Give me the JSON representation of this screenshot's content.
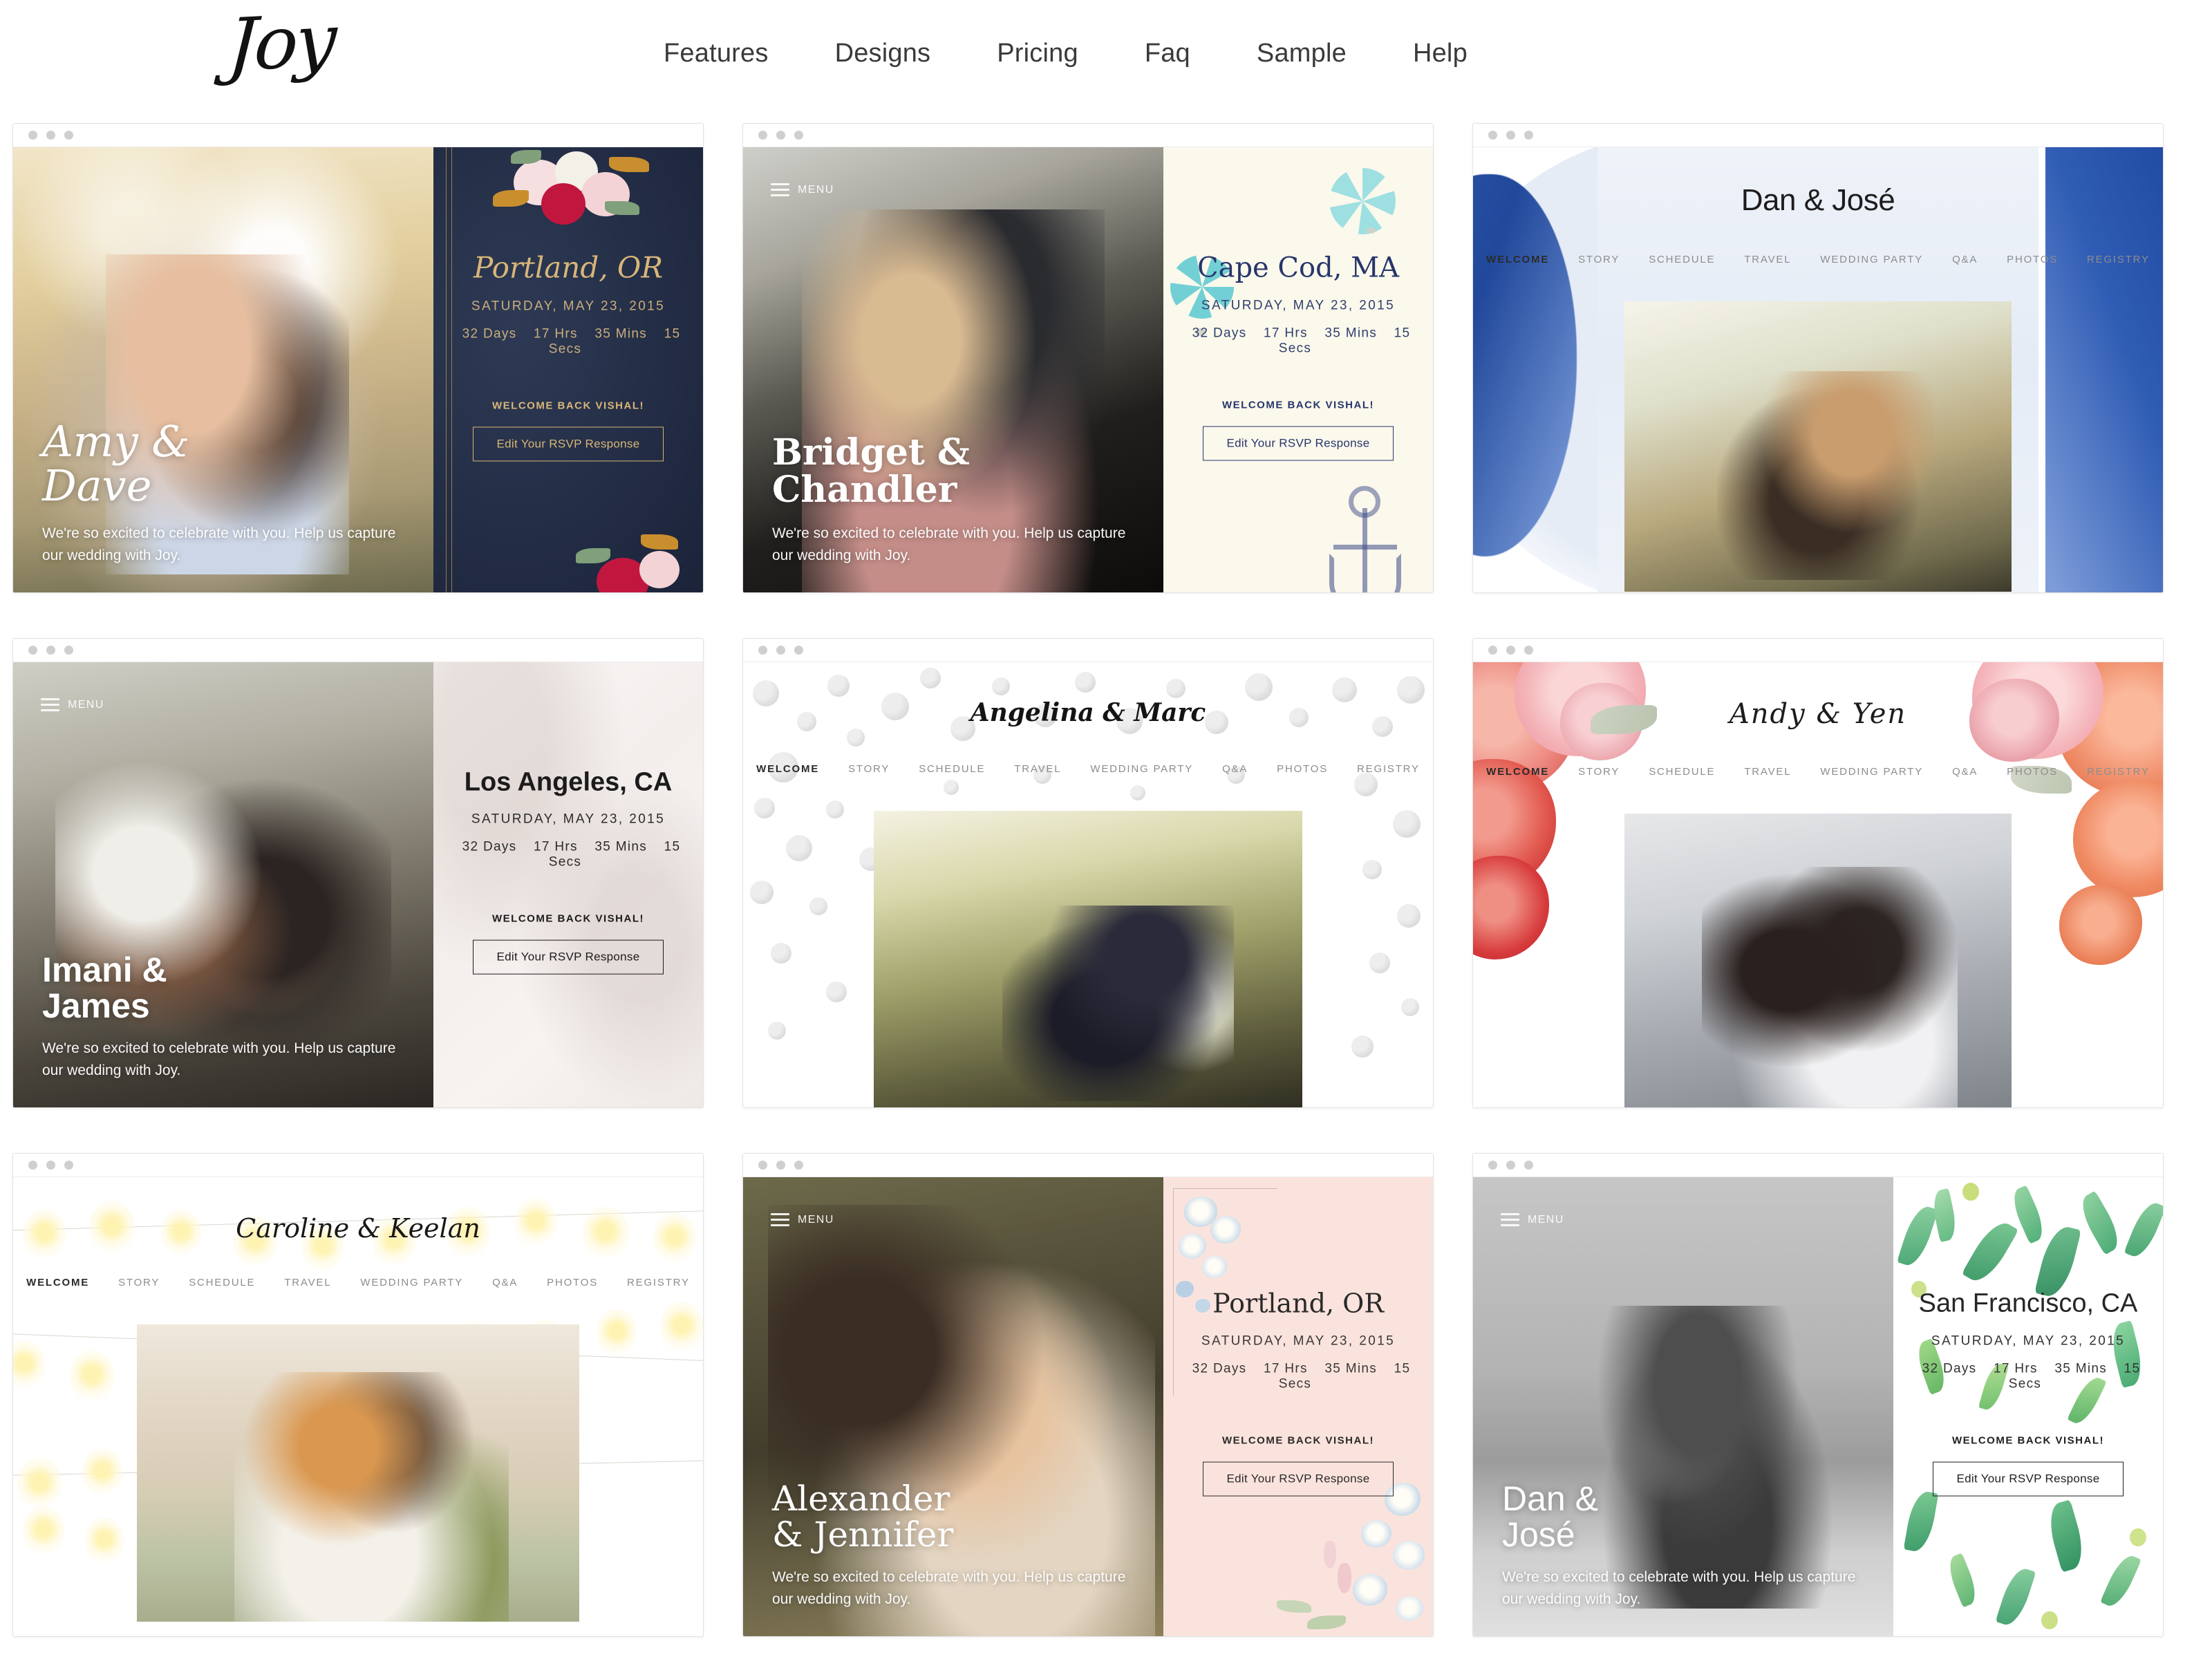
{
  "header": {
    "logo_text": "Joy",
    "nav": [
      {
        "label": "Features"
      },
      {
        "label": "Designs"
      },
      {
        "label": "Pricing"
      },
      {
        "label": "Faq"
      },
      {
        "label": "Sample"
      },
      {
        "label": "Help"
      }
    ]
  },
  "common": {
    "tagline": "We're so excited to celebrate with you. Help us capture our wedding with Joy.",
    "date": "SATURDAY, MAY 23, 2015",
    "countdown_days": "32 Days",
    "countdown_hrs": "17 Hrs",
    "countdown_mins": "35 Mins",
    "countdown_secs": "15 Secs",
    "welcome_back": "WELCOME BACK VISHAL!",
    "rsvp_button": "Edit Your RSVP Response",
    "menu_label": "MENU",
    "site_nav": [
      "WELCOME",
      "STORY",
      "SCHEDULE",
      "TRAVEL",
      "WEDDING PARTY",
      "Q&A",
      "PHOTOS",
      "REGISTRY"
    ]
  },
  "colors": {
    "navy": "#1f2a44",
    "gold": "#c9a063",
    "cream": "#fbf8ec",
    "navy_ink": "#27366b",
    "teal": "#4fc6cf",
    "blush": "#fbe3dd",
    "steel_blue": "#2b55a8",
    "ink": "#2b2b2b",
    "muted": "#8d8d8d"
  },
  "cards": [
    {
      "id": "amy-dave",
      "layout": "split",
      "theme": "navy-floral",
      "couple": "Amy & Dave",
      "couple_line1": "Amy &",
      "couple_line2": "Dave",
      "city": "Portland, OR",
      "menu_visible": false
    },
    {
      "id": "bridget-chandler",
      "layout": "split",
      "theme": "nautical-cream",
      "couple": "Bridget & Chandler",
      "couple_line1": "Bridget &",
      "couple_line2": "Chandler",
      "city": "Cape Cod, MA",
      "menu_visible": true
    },
    {
      "id": "dan-jose-watercolor",
      "layout": "centered",
      "theme": "watercolor-blue",
      "couple": "Dan & José",
      "city": null,
      "menu_visible": false
    },
    {
      "id": "imani-james",
      "layout": "split",
      "theme": "marble",
      "couple": "Imani & James",
      "couple_line1": "Imani &",
      "couple_line2": "James",
      "city": "Los Angeles, CA",
      "menu_visible": true
    },
    {
      "id": "angelina-marc",
      "layout": "centered",
      "theme": "confetti",
      "couple": "Angelina & Marc",
      "city": null,
      "menu_visible": false
    },
    {
      "id": "andy-yen",
      "layout": "centered",
      "theme": "peony-floral",
      "couple": "Andy & Yen",
      "city": null,
      "menu_visible": false
    },
    {
      "id": "caroline-keelan",
      "layout": "centered",
      "theme": "string-lights",
      "couple": "Caroline & Keelan",
      "city": null,
      "menu_visible": false
    },
    {
      "id": "alexander-jennifer",
      "layout": "split",
      "theme": "blush-botanical",
      "couple": "Alexander & Jennifer",
      "couple_line1": "Alexander",
      "couple_line2": "& Jennifer",
      "city": "Portland, OR",
      "menu_visible": true
    },
    {
      "id": "dan-jose-greenery",
      "layout": "split",
      "theme": "greenery",
      "couple": "Dan & José",
      "couple_line1": "Dan &",
      "couple_line2": "José",
      "city": "San Francisco, CA",
      "menu_visible": true
    }
  ]
}
